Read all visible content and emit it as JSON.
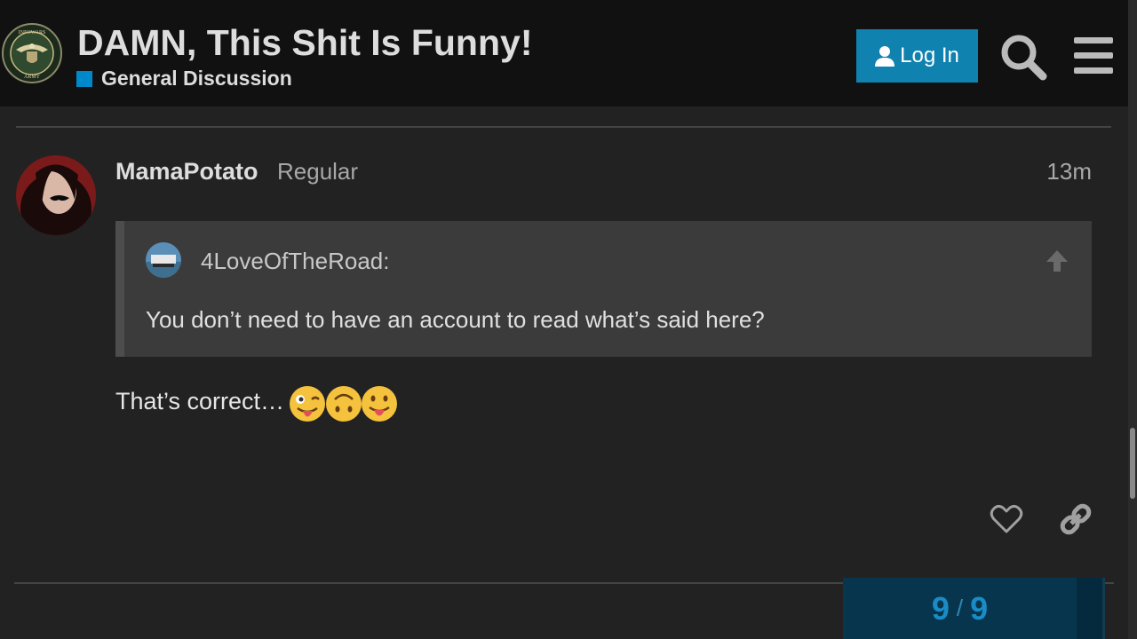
{
  "header": {
    "title": "DAMN, This Shit Is Funny!",
    "category": "General Discussion",
    "category_color": "#0088cc",
    "login_label": "Log In",
    "login_color": "#0f82af",
    "logo_icon": "infowars-army-seal",
    "logo_text_top": "INFOWARS",
    "logo_text_bottom": "ARMY"
  },
  "post": {
    "username": "MamaPotato",
    "user_title": "Regular",
    "date": "13m",
    "quote": {
      "username": "4LoveOfTheRoad:",
      "text": "You don’t need to have an account to read what’s said here?"
    },
    "body": "That’s correct…",
    "emojis": [
      "stuck-out-tongue-winking-eye",
      "upside-down-face",
      "stuck-out-tongue"
    ]
  },
  "progress": {
    "current": "9",
    "separator": "/",
    "total": "9"
  }
}
